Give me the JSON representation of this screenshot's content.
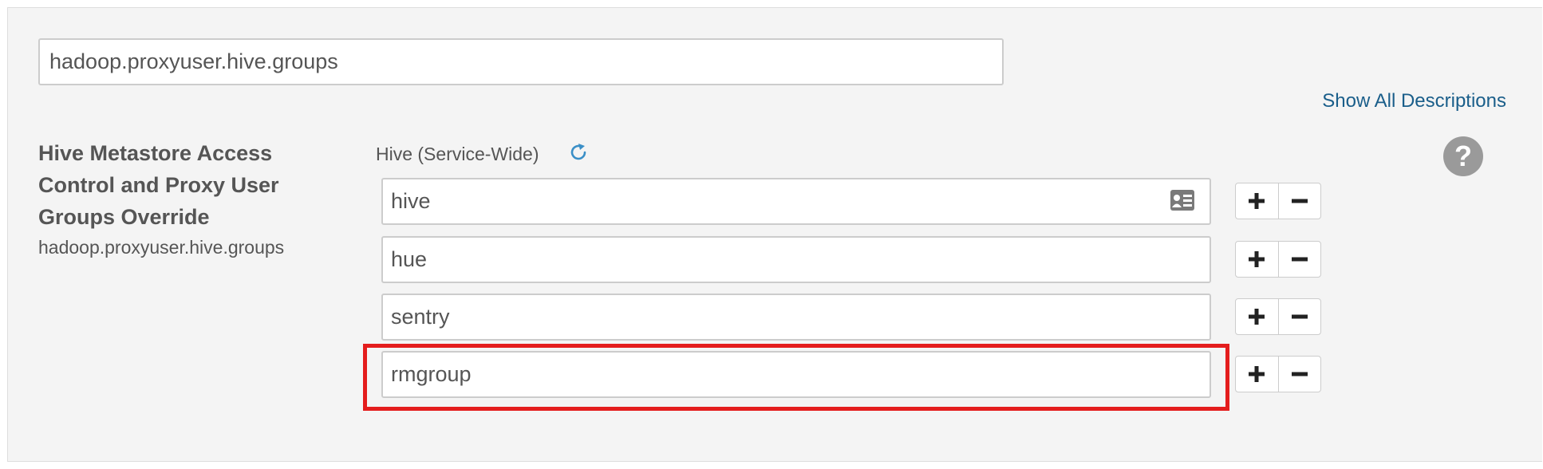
{
  "search": {
    "value": "hadoop.proxyuser.hive.groups"
  },
  "show_all_descriptions": "Show All Descriptions",
  "property": {
    "title": "Hive Metastore Access Control and Proxy User Groups Override",
    "key": "hadoop.proxyuser.hive.groups",
    "scope_label": "Hive (Service-Wide)",
    "values": [
      "hive",
      "hue",
      "sentry",
      "rmgroup"
    ]
  },
  "icons": {
    "refresh": "refresh-icon",
    "help": "question-mark-icon",
    "card": "id-card-icon",
    "plus": "plus-icon",
    "minus": "minus-icon"
  },
  "help_symbol": "?",
  "colors": {
    "link": "#1a5e8a",
    "refresh": "#3a8fc7",
    "highlight": "#e41d1d",
    "help_bg": "#9a9a9a"
  }
}
